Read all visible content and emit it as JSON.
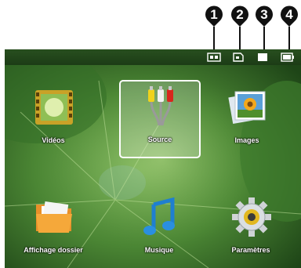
{
  "callouts": [
    "1",
    "2",
    "3",
    "4"
  ],
  "status_icons": [
    "hdmi-icon",
    "sd-card-icon",
    "usb-memory-icon",
    "battery-icon"
  ],
  "menu": {
    "items": [
      {
        "label": "Vidéos",
        "icon": "film-icon",
        "selected": false
      },
      {
        "label": "Source",
        "icon": "av-cables-icon",
        "selected": true
      },
      {
        "label": "Images",
        "icon": "photo-icon",
        "selected": false
      },
      {
        "label": "Affichage dossier",
        "icon": "folder-icon",
        "selected": false
      },
      {
        "label": "Musique",
        "icon": "music-note-icon",
        "selected": false
      },
      {
        "label": "Paramètres",
        "icon": "gear-icon",
        "selected": false
      }
    ]
  },
  "colors": {
    "callout": "#111111",
    "selection_border": "#ffffff",
    "background_green": "#2d5a22"
  }
}
